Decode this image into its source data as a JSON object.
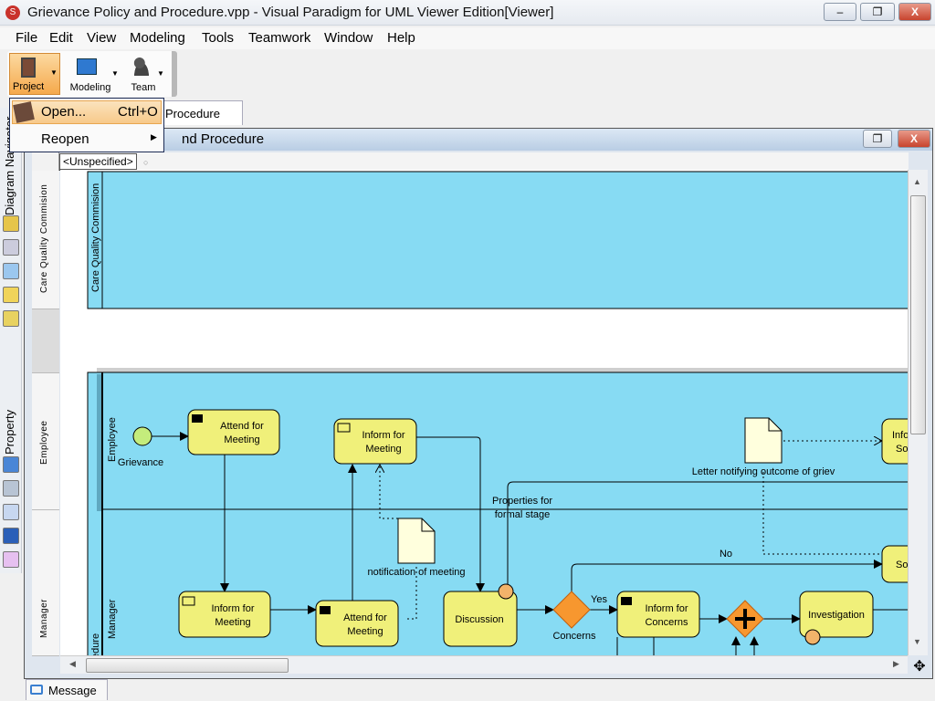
{
  "window": {
    "title": "Grievance Policy and Procedure.vpp - Visual Paradigm for UML Viewer Edition[Viewer]",
    "minimize": "–",
    "restore": "❐",
    "close": "X"
  },
  "menubar": [
    "File",
    "Edit",
    "View",
    "Modeling",
    "Tools",
    "Teamwork",
    "Window",
    "Help"
  ],
  "toolbar": {
    "project": "Project",
    "modeling": "Modeling",
    "team": "Team"
  },
  "project_menu": {
    "open": "Open...",
    "open_shortcut": "Ctrl+O",
    "reopen": "Reopen"
  },
  "doc_tab": "Procedure",
  "inner_window": {
    "title": "nd Procedure",
    "restore": "❐",
    "close": "X"
  },
  "dock": {
    "navigator": "Diagram Navigator",
    "property": "Property"
  },
  "ruler": {
    "unspecified": "<Unspecified>"
  },
  "row_headers": [
    "Care Quality Commision",
    "Employee",
    "Manager"
  ],
  "diagram": {
    "pool1": "Care Quality Commision",
    "pool2": "edure",
    "lane_employee": "Employee",
    "lane_manager": "Manager",
    "start_label": "Grievance",
    "emp_attend": [
      "Attend for",
      "Meeting"
    ],
    "emp_inform": [
      "Inform for",
      "Meeting"
    ],
    "mgr_inform": [
      "Inform for",
      "Meeting"
    ],
    "mgr_attend": [
      "Attend for",
      "Meeting"
    ],
    "discussion": "Discussion",
    "gateway_label": "Concerns",
    "yes": "Yes",
    "no": "No",
    "inform_concerns": [
      "Inform for",
      "Concerns"
    ],
    "investigation": "Investigation",
    "doc_notification": "notification of meeting",
    "doc_letter": "Letter notifying outcome of griev",
    "properties": [
      "Properties for",
      "formal stage"
    ],
    "partial_task1": [
      "Info",
      "So"
    ],
    "partial_task2": "So",
    "colors": {
      "pool": "#87dbf3",
      "task": "#f0f07a",
      "gateway": "#f7972f",
      "start": "#c4ec7c",
      "doc": "#ffffdd"
    }
  },
  "bottom_tab": "Message"
}
